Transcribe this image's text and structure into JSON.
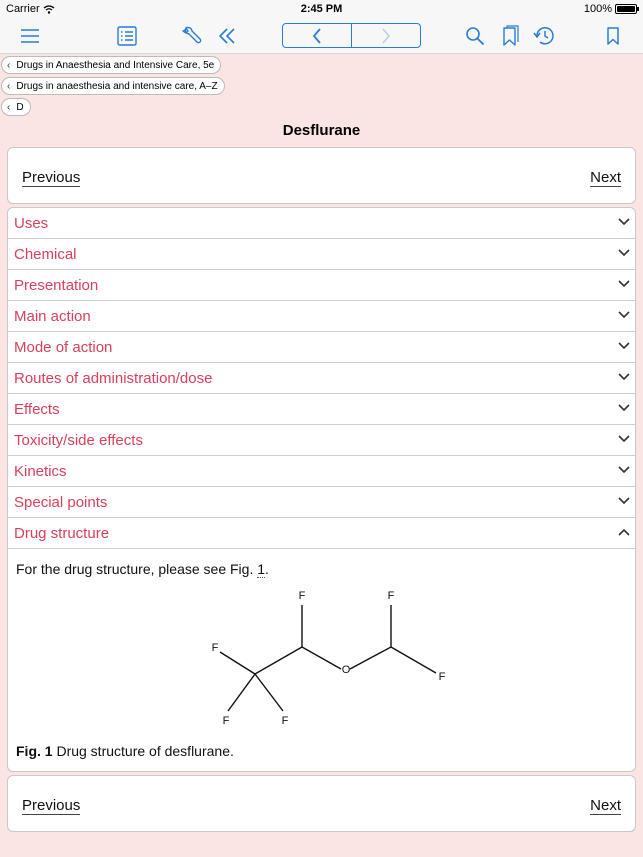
{
  "status": {
    "carrier": "Carrier",
    "time": "2:45 PM",
    "battery": "100%",
    "battery_level": 1.0
  },
  "toolbar": {
    "icons": [
      "menu-icon",
      "contents-list-icon",
      "tools-icon",
      "double-chevron-left-icon",
      "back-icon",
      "forward-icon",
      "search-icon",
      "bookmarks-icon",
      "history-icon",
      "bookmark-icon"
    ],
    "accent": "#2a7dd6"
  },
  "breadcrumbs": [
    "Drugs in Anaesthesia and Intensive Care, 5e",
    "Drugs in anaesthesia and intensive care, A–Z",
    "D"
  ],
  "page": {
    "title": "Desflurane"
  },
  "nav": {
    "previous": "Previous",
    "next": "Next"
  },
  "sections": [
    "Uses",
    "Chemical",
    "Presentation",
    "Main action",
    "Mode of action",
    "Routes of administration/dose",
    "Effects",
    "Toxicity/side effects",
    "Kinetics",
    "Special points",
    "Drug structure"
  ],
  "expanded_section": "Drug structure",
  "drug_structure": {
    "intro_prefix": "For the drug structure, please see Fig. ",
    "intro_ref": "1",
    "intro_suffix": ".",
    "atoms": {
      "f1": "F",
      "f2": "F",
      "f3": "F",
      "f4": "F",
      "f5": "F",
      "f6": "F",
      "o": "O"
    },
    "caption_label": "Fig. 1",
    "caption_text": " Drug structure of desflurane."
  },
  "colors": {
    "background": "#fbe5e3",
    "section_label": "#d9405b",
    "accent": "#2a7dd6"
  }
}
